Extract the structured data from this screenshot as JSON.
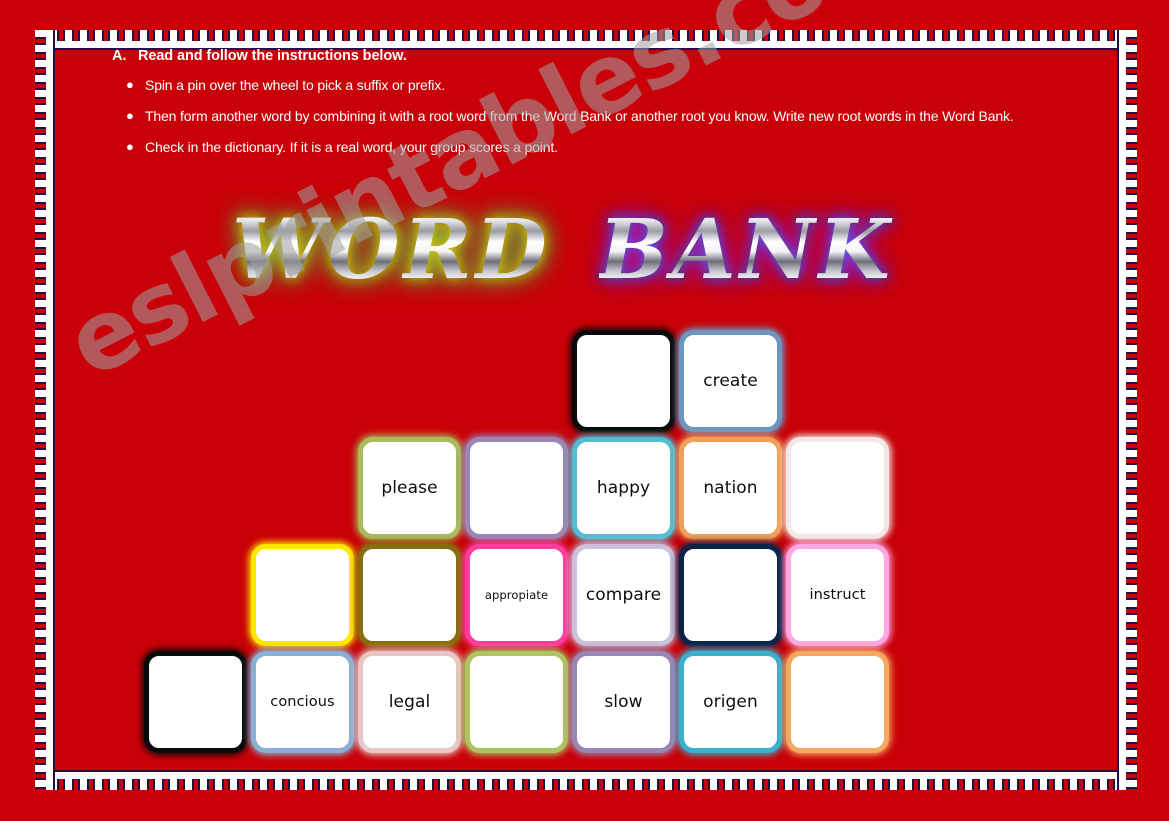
{
  "page": {
    "background_color": "#c90007",
    "text_color": "#ffffff",
    "watermark": "eslprintables.com"
  },
  "instructions": {
    "heading_marker": "A.",
    "heading": "Read and follow the instructions below.",
    "bullet_glyph": "●",
    "bullets": [
      "Spin a pin over the wheel to pick a suffix or prefix.",
      "Then form another word by combining it with a root word from the Word Bank or another root you know. Write new root words in the Word Bank.",
      "Check in the dictionary. If it is a real word, your group scores a point."
    ]
  },
  "title": {
    "word1": "WORD",
    "word2": "BANK",
    "glow1_color": "#ffc800",
    "glow1_secondary": "#78ff5a",
    "glow2_color": "#3c6eff",
    "glow2_secondary": "#ff00be"
  },
  "word_grid": {
    "columns": 7,
    "rows": 4,
    "cells": [
      {
        "row": 1,
        "col": 5,
        "word": "",
        "border_color": "#0a0a0a"
      },
      {
        "row": 1,
        "col": 6,
        "word": "create",
        "border_color": "#6c96c0"
      },
      {
        "row": 2,
        "col": 3,
        "word": "please",
        "border_color": "#a8bc5c"
      },
      {
        "row": 2,
        "col": 4,
        "word": "",
        "border_color": "#9a86b4"
      },
      {
        "row": 2,
        "col": 5,
        "word": "happy",
        "border_color": "#52bcd2"
      },
      {
        "row": 2,
        "col": 6,
        "word": "nation",
        "border_color": "#f0a05a"
      },
      {
        "row": 2,
        "col": 7,
        "word": "",
        "border_color": "#f4e8e6"
      },
      {
        "row": 3,
        "col": 2,
        "word": "",
        "border_color": "#ffe800"
      },
      {
        "row": 3,
        "col": 3,
        "word": "",
        "border_color": "#8a6c10"
      },
      {
        "row": 3,
        "col": 4,
        "word": "appropiate",
        "border_color": "#ff3ca0"
      },
      {
        "row": 3,
        "col": 5,
        "word": "compare",
        "border_color": "#ccc0dc"
      },
      {
        "row": 3,
        "col": 6,
        "word": "",
        "border_color": "#0c2348"
      },
      {
        "row": 3,
        "col": 7,
        "word": "instruct",
        "border_color": "#ffa6e4"
      },
      {
        "row": 4,
        "col": 1,
        "word": "",
        "border_color": "#0a0a0a"
      },
      {
        "row": 4,
        "col": 2,
        "word": "concious",
        "border_color": "#8aafd2"
      },
      {
        "row": 4,
        "col": 3,
        "word": "legal",
        "border_color": "#e8c6c6"
      },
      {
        "row": 4,
        "col": 4,
        "word": "",
        "border_color": "#aec462"
      },
      {
        "row": 4,
        "col": 5,
        "word": "slow",
        "border_color": "#9a86b4"
      },
      {
        "row": 4,
        "col": 6,
        "word": "origen",
        "border_color": "#3ab0cc"
      },
      {
        "row": 4,
        "col": 7,
        "word": "",
        "border_color": "#f4a860"
      }
    ]
  }
}
